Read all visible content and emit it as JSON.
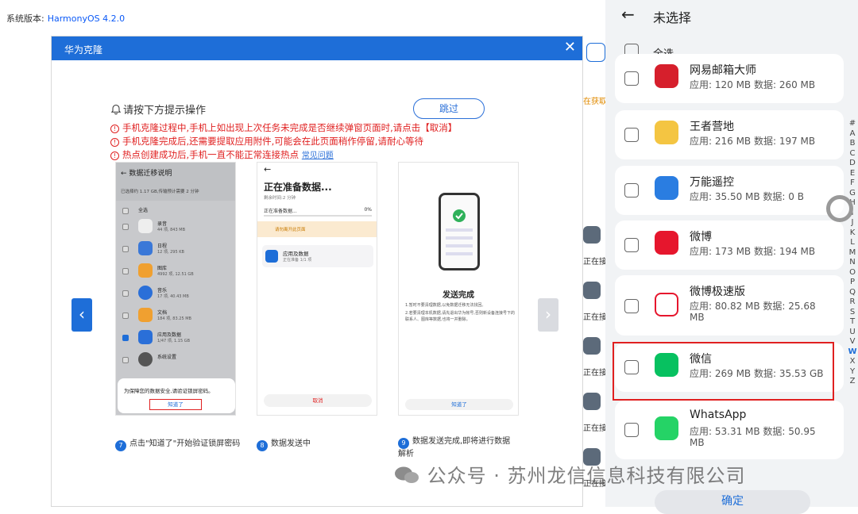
{
  "system": {
    "label": "系统版本:",
    "version": "HarmonyOS 4.2.0"
  },
  "dialog": {
    "title": "华为克隆",
    "prompt": "请按下方提示操作",
    "skip_label": "跳过",
    "warnings": [
      "手机克隆过程中,手机上如出现上次任务未完成是否继续弹窗页面时,请点击【取消】",
      "手机克隆完成后,还需要提取应用附件,可能会在此页面稍作停留,请耐心等待",
      "热点创建成功后,手机一直不能正常连接热点"
    ],
    "faq_link": "常见问题",
    "steps": [
      {
        "number": "7",
        "caption": "点击\"知道了\"开始验证锁屏密码"
      },
      {
        "number": "8",
        "caption": "数据发送中"
      },
      {
        "number": "9",
        "caption": "数据发送完成,即将进行数据解析"
      }
    ],
    "step7": {
      "title": "数据迁移说明",
      "subtitle": "已选择约 1.17 GB,传输预计需要 2 分钟",
      "select_all": "全选",
      "apps": [
        {
          "name": "录音",
          "size": "44 项, 843 MB",
          "checked": false,
          "color": "#ffffff"
        },
        {
          "name": "日程",
          "size": "12 项, 295 KB",
          "checked": false,
          "color": "#3a78d8"
        },
        {
          "name": "图库",
          "size": "4992 项, 12.51 GB",
          "checked": false,
          "color": "#f0a030"
        },
        {
          "name": "音乐",
          "size": "17 项, 40.43 MB",
          "checked": false,
          "color": "#2a6fd8"
        },
        {
          "name": "文档",
          "size": "184 项, 83.25 MB",
          "checked": false,
          "color": "#f0a030"
        },
        {
          "name": "应用及数据",
          "size": "1/47 项, 1.15 GB",
          "checked": true,
          "color": "#2a6fd8"
        },
        {
          "name": "系统设置",
          "size": "",
          "checked": false,
          "color": "#555555"
        }
      ],
      "popup_text": "为保障您的数据安全,请验证锁屏密码。",
      "popup_button": "知道了"
    },
    "step8": {
      "title": "正在准备数据...",
      "remaining": "剩余时间:2 分钟",
      "progress_label": "正在准备数据...",
      "progress_percent": "0%",
      "progress": 0,
      "notice": "请勿离开此页面",
      "item_name": "应用及数据",
      "item_status": "正在准备 1/1 项",
      "cancel": "取消"
    },
    "step9": {
      "title": "发送完成",
      "desc1": "1.暂时不要清理数据,以免数据迁移无法找回。",
      "desc2": "2.若要清理本机数据,请先退出华为帐号,否则新设备连接号下的联系人、图库等数据,也将一并删除。",
      "ok": "知道了"
    }
  },
  "background_strip": {
    "labels": [
      "在获取",
      "正在接",
      "正在接",
      "正在接",
      "正在接",
      "正在接"
    ]
  },
  "phone": {
    "title": "未选择",
    "select_all": "全选",
    "apps": [
      {
        "name": "网易邮箱大师",
        "size": "应用: 120 MB 数据: 260 MB",
        "color": "#d61f2c",
        "checked": false
      },
      {
        "name": "王者营地",
        "size": "应用: 216 MB 数据: 197 MB",
        "color": "#f4c542",
        "checked": false
      },
      {
        "name": "万能遥控",
        "size": "应用: 35.50 MB 数据: 0 B",
        "color": "#2a7de1",
        "checked": false
      },
      {
        "name": "微博",
        "size": "应用: 173 MB 数据: 194 MB",
        "color": "#e6162d",
        "checked": false
      },
      {
        "name": "微博极速版",
        "size": "应用: 80.82 MB 数据: 25.68 MB",
        "color": "#ffffff",
        "checked": false
      },
      {
        "name": "微信",
        "size": "应用: 269 MB 数据: 35.53 GB",
        "color": "#07c160",
        "checked": false
      },
      {
        "name": "WhatsApp",
        "size": "应用: 53.31 MB 数据: 50.95 MB",
        "color": "#25d366",
        "checked": false
      }
    ],
    "index_letters": [
      "#",
      "A",
      "B",
      "C",
      "D",
      "E",
      "F",
      "G",
      "H",
      "I",
      "J",
      "K",
      "L",
      "M",
      "N",
      "O",
      "P",
      "Q",
      "R",
      "S",
      "T",
      "U",
      "V",
      "W",
      "X",
      "Y",
      "Z"
    ],
    "active_letter": "W",
    "confirm": "确定"
  },
  "watermark": "公众号 · 苏州龙信信息科技有限公司",
  "colors": {
    "accent": "#1e6ed8",
    "warning": "#e02020",
    "highlight": "#e02020"
  }
}
